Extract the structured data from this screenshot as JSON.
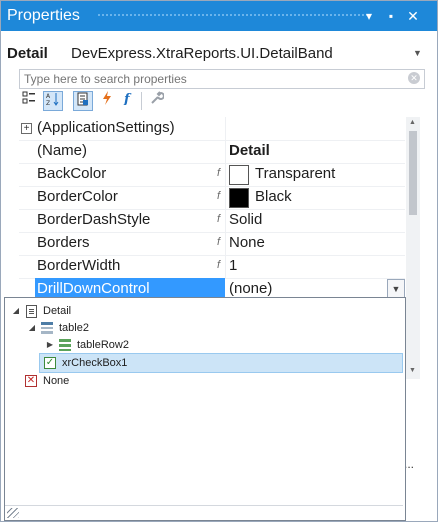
{
  "window": {
    "title": "Properties"
  },
  "selector": {
    "object_name": "Detail",
    "object_type": "DevExpress.XtraReports.UI.DetailBand"
  },
  "search": {
    "placeholder": "Type here to search properties"
  },
  "toolbar": {
    "icons": [
      "categorized-icon",
      "alphabetical-icon",
      "properties-icon",
      "events-icon",
      "expressions-icon",
      "wrench-icon"
    ]
  },
  "grid": {
    "rows": [
      {
        "name": "(ApplicationSettings)",
        "value": ""
      },
      {
        "name": "(Name)",
        "value": "Detail"
      },
      {
        "name": "BackColor",
        "value": "Transparent",
        "swatch": "#ffffff"
      },
      {
        "name": "BorderColor",
        "value": "Black",
        "swatch": "#000000"
      },
      {
        "name": "BorderDashStyle",
        "value": "Solid"
      },
      {
        "name": "Borders",
        "value": "None"
      },
      {
        "name": "BorderWidth",
        "value": "1"
      },
      {
        "name": "DrillDownControl",
        "value": "(none)"
      }
    ]
  },
  "tree": {
    "nodes": [
      {
        "label": "Detail",
        "icon": "document-icon"
      },
      {
        "label": "table2",
        "icon": "table-icon"
      },
      {
        "label": "tableRow2",
        "icon": "table-row-icon"
      },
      {
        "label": "xrCheckBox1",
        "icon": "checkbox-icon"
      },
      {
        "label": "None",
        "icon": "none-icon"
      }
    ]
  },
  "misc": {
    "ellipsis": "..."
  },
  "colors": {
    "title_bar": "#1e88d9",
    "selection": "#3399ff",
    "tree_selection": "#cce4f7"
  }
}
